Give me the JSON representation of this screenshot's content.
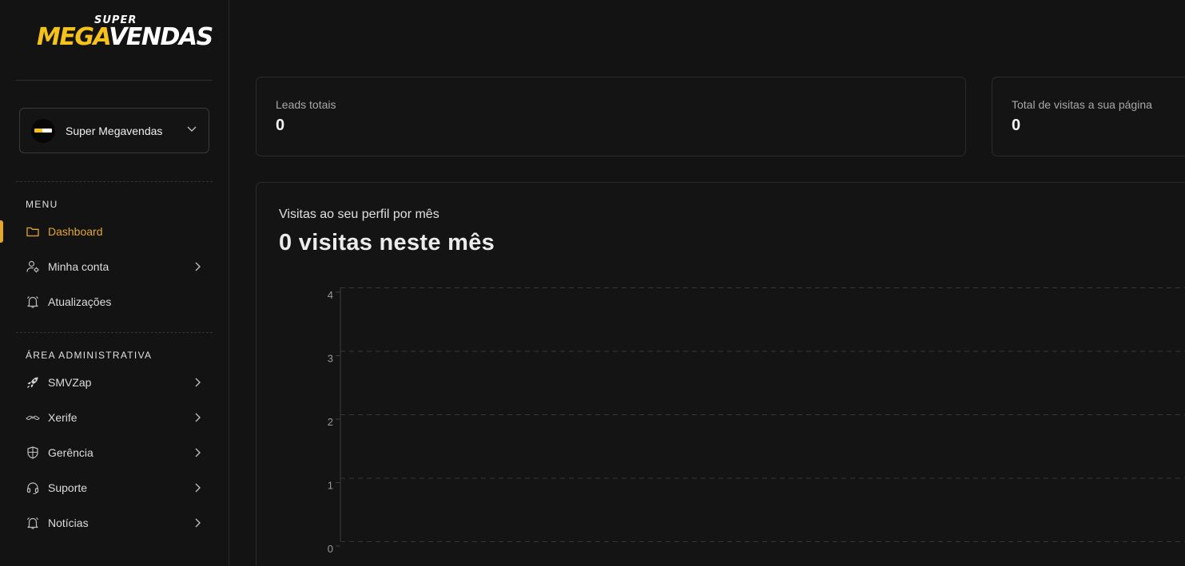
{
  "brand": {
    "super": "SUPER",
    "mega": "MEGA",
    "vendas": "VENDAS"
  },
  "account": {
    "name": "Super Megavendas"
  },
  "menu": {
    "title": "MENU",
    "items": [
      {
        "label": "Dashboard",
        "icon": "folder-icon",
        "active": true,
        "chevron": false
      },
      {
        "label": "Minha conta",
        "icon": "user-gear-icon",
        "active": false,
        "chevron": true
      },
      {
        "label": "Atualizações",
        "icon": "bell-icon",
        "active": false,
        "chevron": false
      }
    ]
  },
  "admin": {
    "title": "ÁREA ADMINISTRATIVA",
    "items": [
      {
        "label": "SMVZap",
        "icon": "rocket-icon",
        "chevron": true
      },
      {
        "label": "Xerife",
        "icon": "mustache-icon",
        "chevron": true
      },
      {
        "label": "Gerência",
        "icon": "shield-icon",
        "chevron": true
      },
      {
        "label": "Suporte",
        "icon": "headset-icon",
        "chevron": true
      },
      {
        "label": "Notícias",
        "icon": "bell-icon",
        "chevron": true
      }
    ]
  },
  "stats": [
    {
      "label": "Leads totais",
      "value": "0"
    },
    {
      "label": "Total de visitas a sua página",
      "value": "0"
    }
  ],
  "chart_card": {
    "subtitle": "Visitas ao seu perfil por mês",
    "title": "0 visitas neste mês"
  },
  "colors": {
    "accent": "#e3a72f",
    "logo_yellow": "#f4c21b",
    "background": "#131313",
    "card": "#141414"
  },
  "chart_data": {
    "type": "line",
    "title": "",
    "xlabel": "",
    "ylabel": "",
    "ylim": [
      0,
      4
    ],
    "yticks": [
      "0",
      "1",
      "2",
      "3",
      "4"
    ],
    "x": [],
    "series": [],
    "grid": true
  }
}
